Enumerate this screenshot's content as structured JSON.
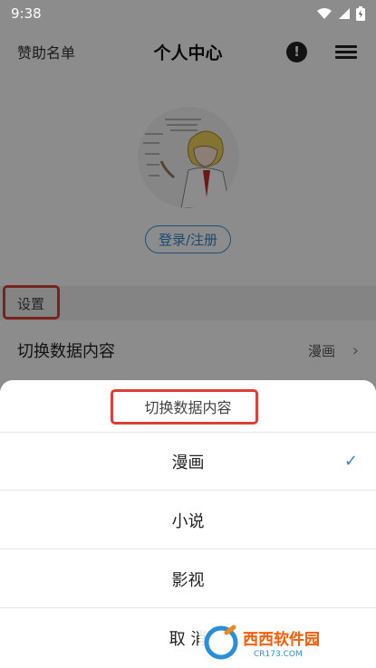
{
  "status_bar": {
    "time": "9:38"
  },
  "header": {
    "sponsor_label": "赞助名单",
    "title": "个人中心",
    "alert_glyph": "!"
  },
  "profile": {
    "login_label": "登录/注册"
  },
  "settings": {
    "section_label": "设置",
    "switch_label": "切换数据内容",
    "switch_value": "漫画"
  },
  "sheet": {
    "title": "切换数据内容",
    "options": [
      {
        "label": "漫画",
        "selected": true
      },
      {
        "label": "小说",
        "selected": false
      },
      {
        "label": "影视",
        "selected": false
      }
    ],
    "cancel_label": "取 消"
  },
  "watermark": {
    "main": "西西软件园",
    "sub": "CR173.COM"
  },
  "colors": {
    "accent_blue": "#2e86d6",
    "highlight_red": "#d9403a"
  }
}
